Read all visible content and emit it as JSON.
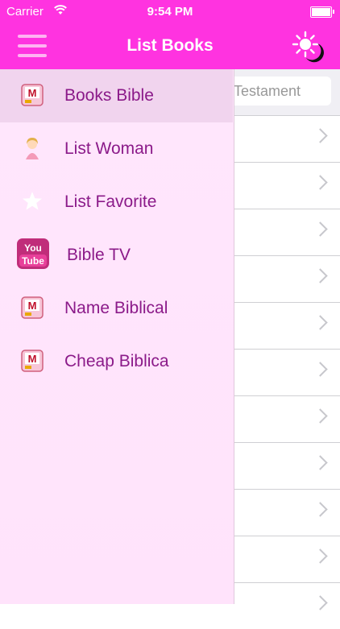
{
  "status_bar": {
    "carrier": "Carrier",
    "time": "9:54 PM"
  },
  "nav": {
    "title": "List Books",
    "menu_icon": "hamburger-icon",
    "theme_icon": "sun-moon-icon"
  },
  "search": {
    "placeholder": "Testament"
  },
  "drawer": {
    "items": [
      {
        "label": "Books Bible",
        "icon": "bible-book-icon",
        "active": true
      },
      {
        "label": "List Woman",
        "icon": "woman-icon",
        "active": false
      },
      {
        "label": "List Favorite",
        "icon": "star-icon",
        "active": false
      },
      {
        "label": "Bible TV",
        "icon": "youtube-icon",
        "active": false
      },
      {
        "label": "Name Biblical",
        "icon": "bible-book-icon",
        "active": false
      },
      {
        "label": "Cheap Biblica",
        "icon": "bible-book-icon",
        "active": false
      }
    ]
  },
  "colors": {
    "nav": "#ff33e0",
    "drawer_text": "#8b1a89",
    "drawer_bg": "#ffe6fc",
    "active_item": "#f1d4ee"
  }
}
